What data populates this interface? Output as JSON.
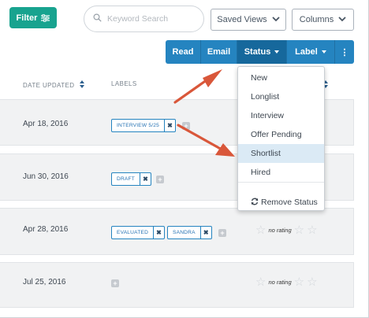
{
  "toolbar": {
    "filter_label": "Filter",
    "search_placeholder": "Keyword Search",
    "saved_views_label": "Saved Views",
    "columns_label": "Columns"
  },
  "actions": {
    "read": "Read",
    "email": "Email",
    "status": "Status",
    "label": "Label",
    "more": "⋮"
  },
  "table": {
    "headers": {
      "date_updated": "DATE UPDATED",
      "labels": "LABELS"
    },
    "rows": [
      {
        "date": "Apr 18, 2016",
        "labels": [
          "INTERVIEW 5/25"
        ],
        "rating": ""
      },
      {
        "date": "Jun 30, 2016",
        "labels": [
          "DRAFT"
        ],
        "rating": ""
      },
      {
        "date": "Apr 28, 2016",
        "labels": [
          "EVALUATED",
          "SANDRA"
        ],
        "rating": "no rating"
      },
      {
        "date": "Jul 25, 2016",
        "labels": [],
        "rating": "no rating"
      }
    ]
  },
  "status_menu": {
    "items": [
      "New",
      "Longlist",
      "Interview",
      "Offer Pending",
      "Shortlist",
      "Hired"
    ],
    "highlighted": "Shortlist",
    "remove_label": "Remove Status"
  },
  "colors": {
    "filter_green": "#18a38f",
    "action_blue": "#2584c0",
    "status_active": "#16689c",
    "annotation_arrow": "#d9573a",
    "highlight": "#dbeaf5"
  }
}
